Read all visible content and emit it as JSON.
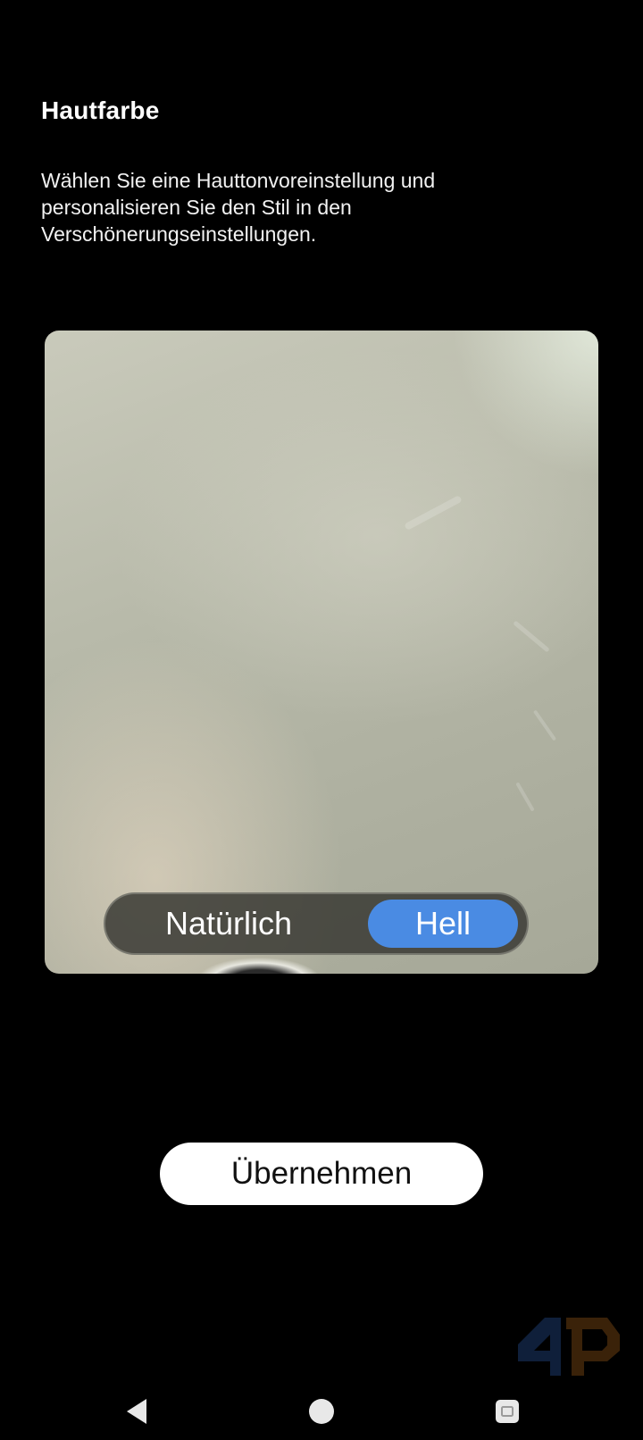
{
  "screen": {
    "title": "Hautfarbe",
    "description": "Wählen Sie eine Hauttonvoreinstellung und personalisieren Sie den Stil in den Verschönerungseinstellungen."
  },
  "preview": {
    "tone_options": {
      "natural": "Natürlich",
      "light": "Hell"
    },
    "selected": "light"
  },
  "actions": {
    "apply_label": "Übernehmen"
  },
  "navbar": {
    "icons": [
      "back-icon",
      "home-icon",
      "recents-icon"
    ]
  },
  "colors": {
    "background": "#000000",
    "accent": "#4a8be3",
    "button_bg": "#ffffff"
  }
}
